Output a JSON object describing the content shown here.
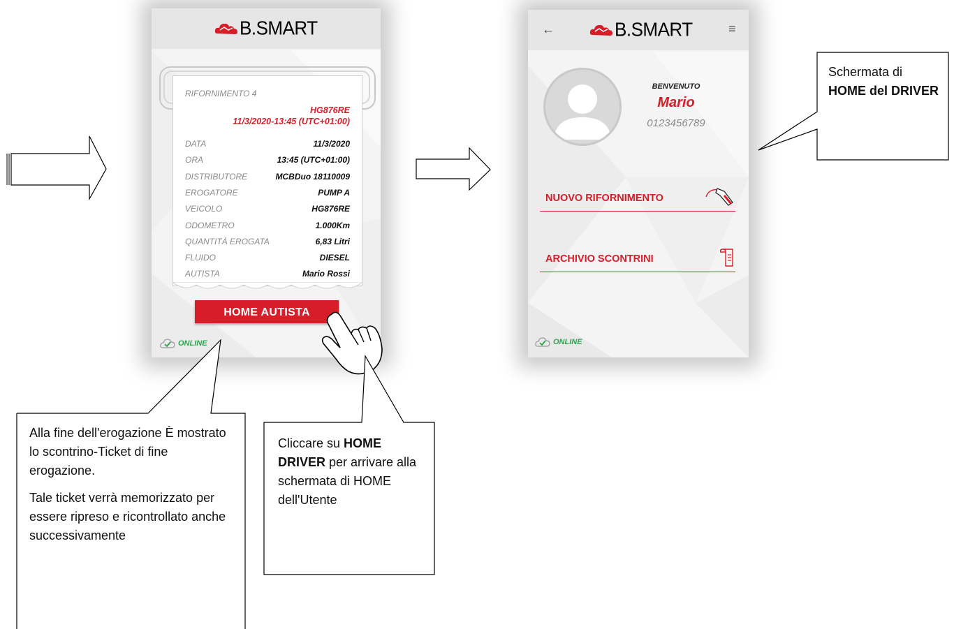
{
  "receipt_screen": {
    "logo": "B.SMART",
    "title": "RIFORNIMENTO 4",
    "plate_red": "HG876RE",
    "datetime_red": "11/3/2020-13:45 (UTC+01:00)",
    "rows": [
      {
        "key": "DATA",
        "value": "11/3/2020"
      },
      {
        "key": "ORA",
        "value": "13:45 (UTC+01:00)"
      },
      {
        "key": "DISTRIBUTORE",
        "value": "MCBDuo 18110009"
      },
      {
        "key": "EROGATORE",
        "value": "PUMP A"
      },
      {
        "key": "VEICOLO",
        "value": "HG876RE"
      },
      {
        "key": "ODOMETRO",
        "value": "1.000Km"
      },
      {
        "key": "QUANTITÀ EROGATA",
        "value": "6,83 Litri"
      },
      {
        "key": "FLUIDO",
        "value": "DIESEL"
      },
      {
        "key": "AUTISTA",
        "value": "Mario Rossi"
      }
    ],
    "home_button": "HOME AUTISTA",
    "status": "ONLINE"
  },
  "home_screen": {
    "logo": "B.SMART",
    "welcome": "BENVENUTO",
    "name": "Mario",
    "phone": "0123456789",
    "menu": [
      {
        "label": "NUOVO RIFORNIMENTO",
        "icon": "fuel-nozzle-icon"
      },
      {
        "label": "ARCHIVIO SCONTRINI",
        "icon": "receipt-scroll-icon"
      }
    ],
    "status": "ONLINE"
  },
  "callouts": {
    "receipt_p1": "Alla fine dell'erogazione È mostrato lo scontrino-Ticket di fine erogazione.",
    "receipt_p2": "Tale ticket verrà memorizzato per essere ripreso e ricontrollato anche successivamente",
    "click_pre": "Cliccare su ",
    "click_bold": "HOME DRIVER",
    "click_post": " per arrivare alla schermata di HOME dell'Utente",
    "home_pre": "Schermata di ",
    "home_bold": "HOME del DRIVER"
  },
  "colors": {
    "accent": "#d71e28",
    "online": "#2ea44f",
    "topbar": "#e6e6e6"
  }
}
